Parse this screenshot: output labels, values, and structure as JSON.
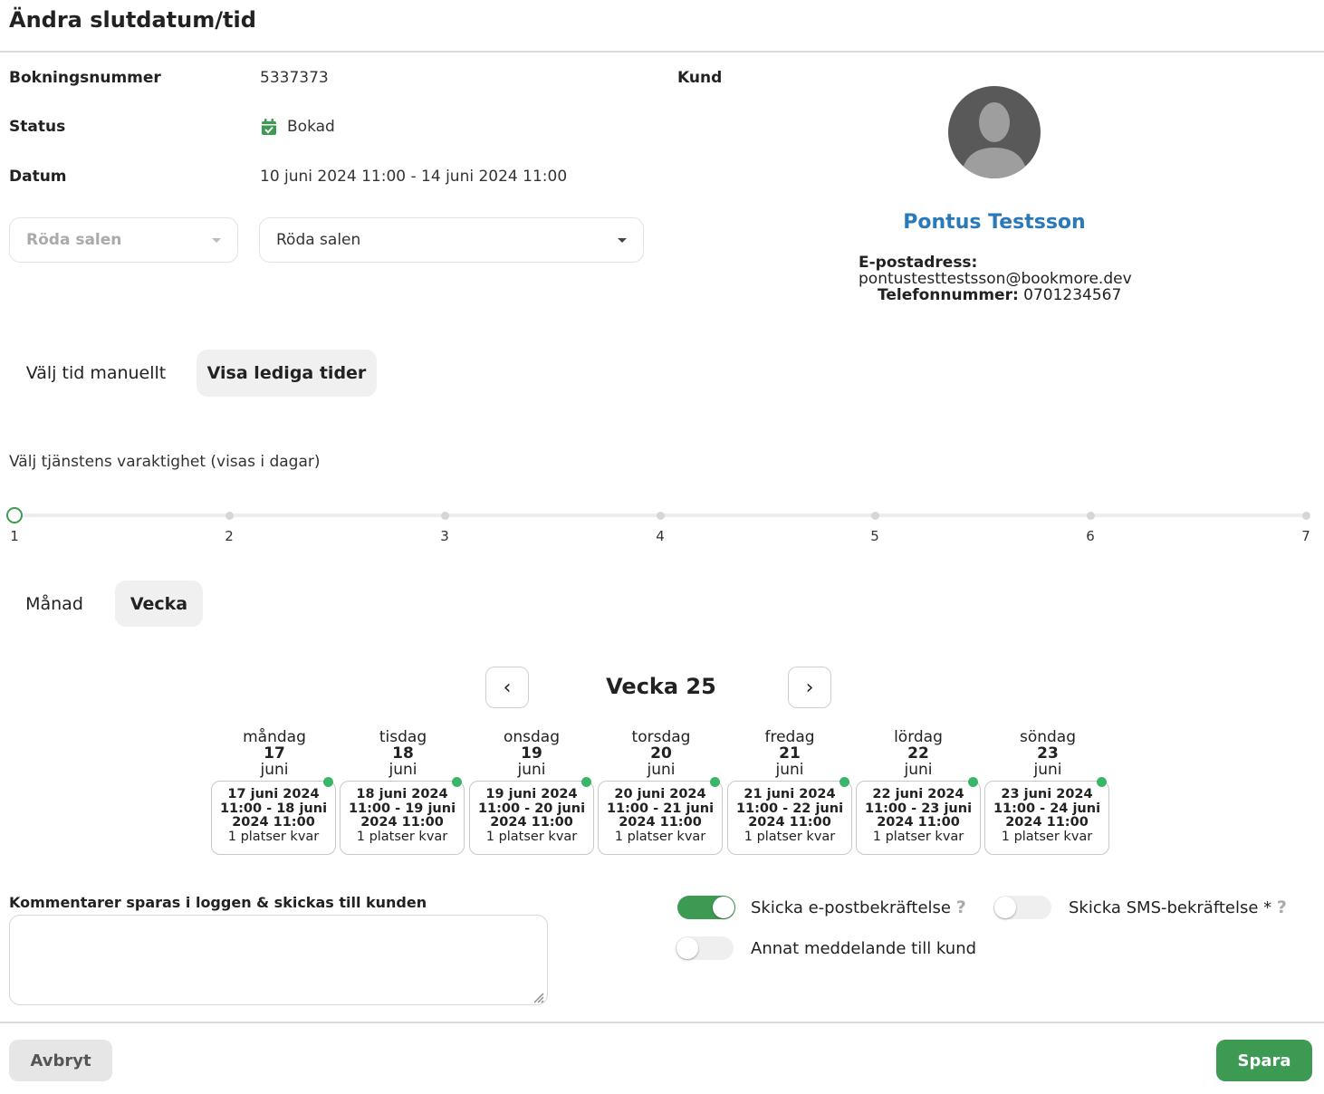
{
  "dialog": {
    "title": "Ändra slutdatum/tid"
  },
  "booking": {
    "number_label": "Bokningsnummer",
    "number_value": "5337373",
    "status_label": "Status",
    "status_value": "Bokad",
    "date_label": "Datum",
    "date_value": "10 juni 2024 11:00 - 14 juni 2024 11:00",
    "resource_select_disabled": "Röda salen",
    "resource_select": "Röda salen"
  },
  "customer": {
    "label": "Kund",
    "name": "Pontus Testsson",
    "email_label": "E-postadress:",
    "email": "pontustesttestsson@bookmore.dev",
    "phone_label": "Telefonnummer:",
    "phone": "0701234567"
  },
  "mode_tabs": [
    {
      "label": "Välj tid manuellt",
      "active": false
    },
    {
      "label": "Visa lediga tider",
      "active": true
    }
  ],
  "duration": {
    "label": "Välj tjänstens varaktighet (visas i dagar)",
    "ticks": [
      "1",
      "2",
      "3",
      "4",
      "5",
      "6",
      "7"
    ],
    "selected": 1
  },
  "view_tabs": [
    {
      "label": "Månad",
      "active": false
    },
    {
      "label": "Vecka",
      "active": true
    }
  ],
  "calendar": {
    "week_label": "Vecka 25",
    "prev_icon": "‹",
    "next_icon": "›",
    "days": [
      {
        "weekday": "måndag",
        "day": "17",
        "month": "juni",
        "slot_date": "17 juni 2024",
        "slot_range": "11:00 - 18 juni",
        "slot_end": "2024 11:00",
        "slot_avail": "1 platser kvar"
      },
      {
        "weekday": "tisdag",
        "day": "18",
        "month": "juni",
        "slot_date": "18 juni 2024",
        "slot_range": "11:00 - 19 juni",
        "slot_end": "2024 11:00",
        "slot_avail": "1 platser kvar"
      },
      {
        "weekday": "onsdag",
        "day": "19",
        "month": "juni",
        "slot_date": "19 juni 2024",
        "slot_range": "11:00 - 20 juni",
        "slot_end": "2024 11:00",
        "slot_avail": "1 platser kvar"
      },
      {
        "weekday": "torsdag",
        "day": "20",
        "month": "juni",
        "slot_date": "20 juni 2024",
        "slot_range": "11:00 - 21 juni",
        "slot_end": "2024 11:00",
        "slot_avail": "1 platser kvar"
      },
      {
        "weekday": "fredag",
        "day": "21",
        "month": "juni",
        "slot_date": "21 juni 2024",
        "slot_range": "11:00 - 22 juni",
        "slot_end": "2024 11:00",
        "slot_avail": "1 platser kvar"
      },
      {
        "weekday": "lördag",
        "day": "22",
        "month": "juni",
        "slot_date": "22 juni 2024",
        "slot_range": "11:00 - 23 juni",
        "slot_end": "2024 11:00",
        "slot_avail": "1 platser kvar"
      },
      {
        "weekday": "söndag",
        "day": "23",
        "month": "juni",
        "slot_date": "23 juni 2024",
        "slot_range": "11:00 - 24 juni",
        "slot_end": "2024 11:00",
        "slot_avail": "1 platser kvar"
      }
    ]
  },
  "comment": {
    "label": "Kommentarer sparas i loggen & skickas till kunden",
    "value": ""
  },
  "notifications": {
    "email_label": "Skicka e-postbekräftelse",
    "email_on": true,
    "sms_label": "Skicka SMS-bekräftelse *",
    "sms_on": false,
    "other_label": "Annat meddelande till kund",
    "other_on": false,
    "help_icon": "?"
  },
  "footer": {
    "cancel_label": "Avbryt",
    "save_label": "Spara"
  },
  "colors": {
    "accent_green": "#3d9a52",
    "link_blue": "#2a79b9",
    "available_dot": "#3bb569"
  }
}
